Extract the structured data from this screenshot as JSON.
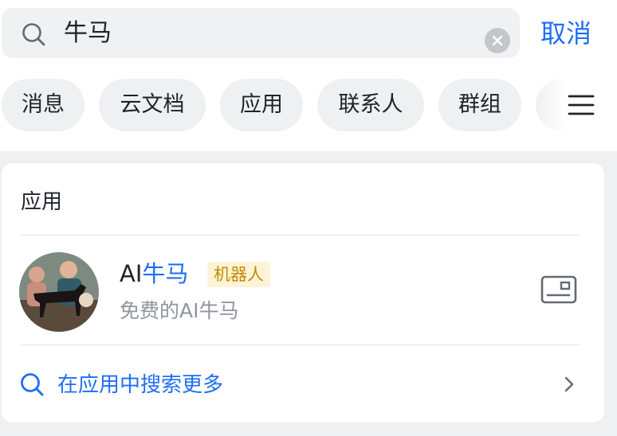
{
  "search": {
    "query": "牛马",
    "cancel_label": "取消"
  },
  "filter_chips": [
    {
      "label": "消息"
    },
    {
      "label": "云文档"
    },
    {
      "label": "应用"
    },
    {
      "label": "联系人"
    },
    {
      "label": "群组"
    }
  ],
  "results": {
    "section_title": "应用",
    "app": {
      "name_prefix": "AI",
      "name_highlight": "牛马",
      "badge": "机器人",
      "description": "免费的AI牛马"
    },
    "more_label": "在应用中搜索更多"
  },
  "colors": {
    "accent": "#1f6ef6",
    "badge_bg": "#fdf3d6",
    "badge_text": "#c28a00",
    "muted_text": "#8f959e"
  },
  "icons": [
    "search-icon",
    "clear-icon",
    "menu-icon",
    "contact-card-icon",
    "chevron-right-icon"
  ]
}
